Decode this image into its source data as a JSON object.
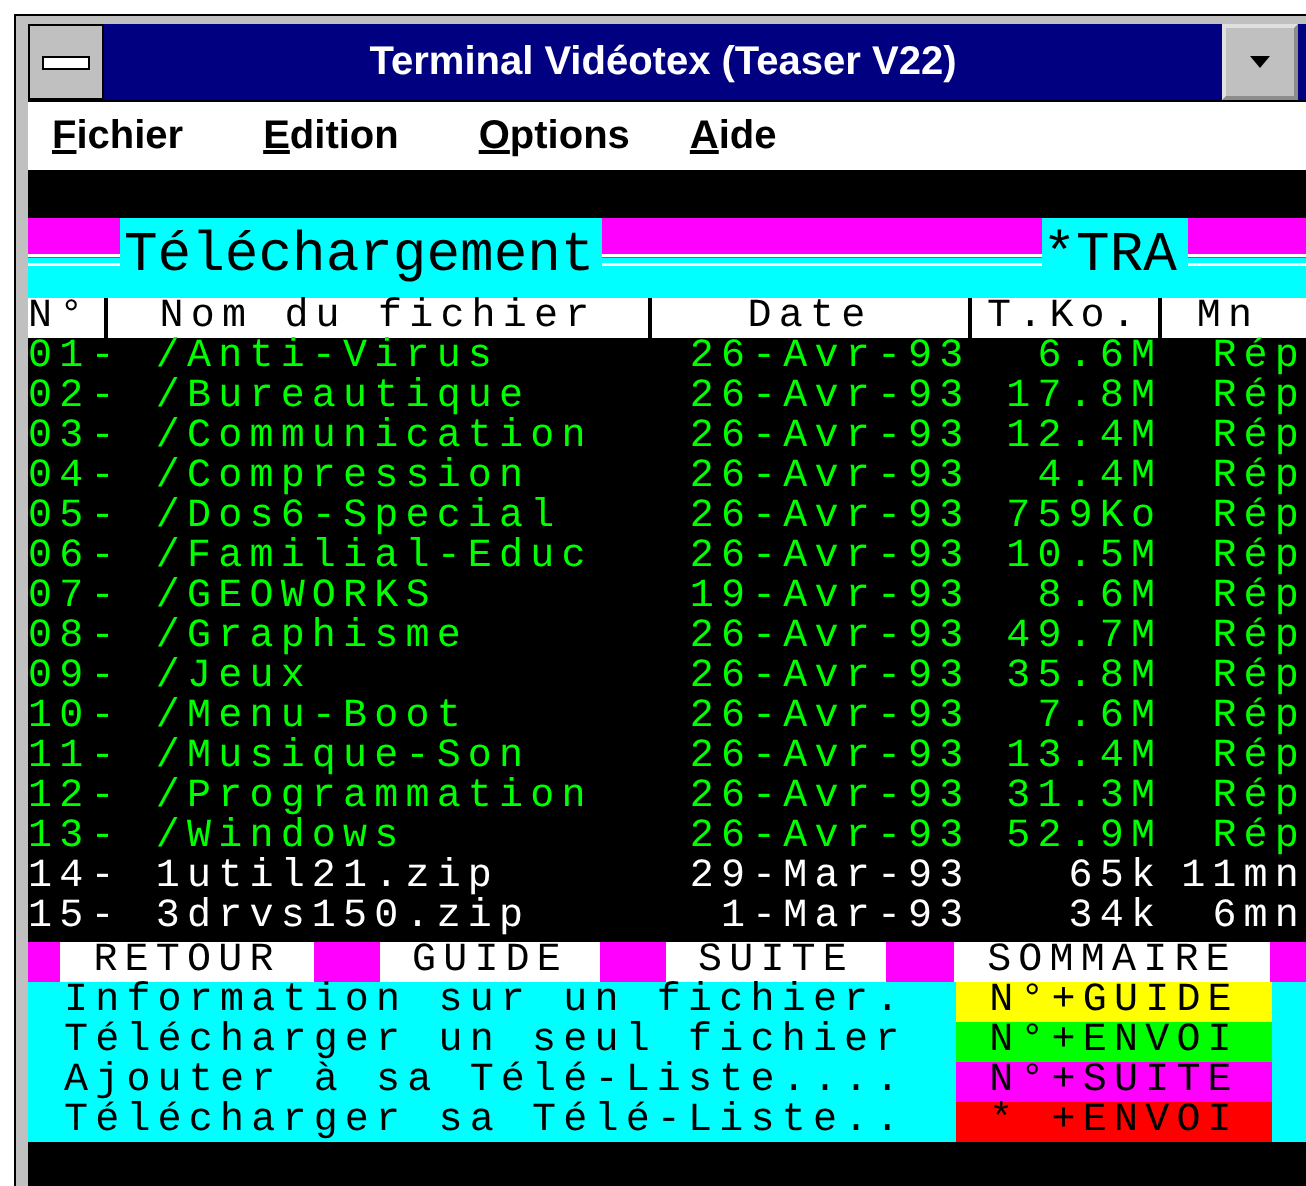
{
  "window": {
    "title": "Terminal Vidéotex (Teaser V22)"
  },
  "menu": [
    "Fichier",
    "Edition",
    "Options",
    "Aide"
  ],
  "banner": {
    "title": "Téléchargement",
    "code": "*TRA"
  },
  "table": {
    "columns": [
      "N°",
      "Nom du fichier",
      "Date",
      "T.Ko.",
      "Mn"
    ],
    "rows": [
      {
        "kind": "directory",
        "num": "01-",
        "name": "/Anti-Virus",
        "date": "26-Avr-93",
        "size": "6.6M",
        "mn": "Rép"
      },
      {
        "kind": "directory",
        "num": "02-",
        "name": "/Bureautique",
        "date": "26-Avr-93",
        "size": "17.8M",
        "mn": "Rép"
      },
      {
        "kind": "directory",
        "num": "03-",
        "name": "/Communication",
        "date": "26-Avr-93",
        "size": "12.4M",
        "mn": "Rép"
      },
      {
        "kind": "directory",
        "num": "04-",
        "name": "/Compression",
        "date": "26-Avr-93",
        "size": "4.4M",
        "mn": "Rép"
      },
      {
        "kind": "directory",
        "num": "05-",
        "name": "/Dos6-Special",
        "date": "26-Avr-93",
        "size": "759Ko",
        "mn": "Rép"
      },
      {
        "kind": "directory",
        "num": "06-",
        "name": "/Familial-Educ",
        "date": "26-Avr-93",
        "size": "10.5M",
        "mn": "Rép"
      },
      {
        "kind": "directory",
        "num": "07-",
        "name": "/GEOWORKS",
        "date": "19-Avr-93",
        "size": "8.6M",
        "mn": "Rép"
      },
      {
        "kind": "directory",
        "num": "08-",
        "name": "/Graphisme",
        "date": "26-Avr-93",
        "size": "49.7M",
        "mn": "Rép"
      },
      {
        "kind": "directory",
        "num": "09-",
        "name": "/Jeux",
        "date": "26-Avr-93",
        "size": "35.8M",
        "mn": "Rép"
      },
      {
        "kind": "directory",
        "num": "10-",
        "name": "/Menu-Boot",
        "date": "26-Avr-93",
        "size": "7.6M",
        "mn": "Rép"
      },
      {
        "kind": "directory",
        "num": "11-",
        "name": "/Musique-Son",
        "date": "26-Avr-93",
        "size": "13.4M",
        "mn": "Rép"
      },
      {
        "kind": "directory",
        "num": "12-",
        "name": "/Programmation",
        "date": "26-Avr-93",
        "size": "31.3M",
        "mn": "Rép"
      },
      {
        "kind": "directory",
        "num": "13-",
        "name": "/Windows",
        "date": "26-Avr-93",
        "size": "52.9M",
        "mn": "Rép"
      },
      {
        "kind": "file",
        "num": "14-",
        "name": "1util21.zip",
        "date": "29-Mar-93",
        "size": "65k",
        "mn": "11mn"
      },
      {
        "kind": "file",
        "num": "15-",
        "name": "3drvs150.zip",
        "date": "1-Mar-93",
        "size": "34k",
        "mn": "6mn"
      }
    ]
  },
  "function_keys": [
    "RETOUR",
    "GUIDE",
    "SUITE",
    "SOMMAIRE"
  ],
  "actions": [
    {
      "text": "Information sur un fichier.",
      "key": "N°+GUIDE",
      "color": "#ffff00"
    },
    {
      "text": "Télécharger un seul fichier",
      "key": "N°+ENVOI",
      "color": "#00ff00"
    },
    {
      "text": "Ajouter à sa Télé-Liste....",
      "key": "N°+SUITE",
      "color": "#ff00ff"
    },
    {
      "text": "Télécharger sa Télé-Liste..",
      "key": "*  +ENVOI",
      "color": "#ff0000"
    }
  ]
}
